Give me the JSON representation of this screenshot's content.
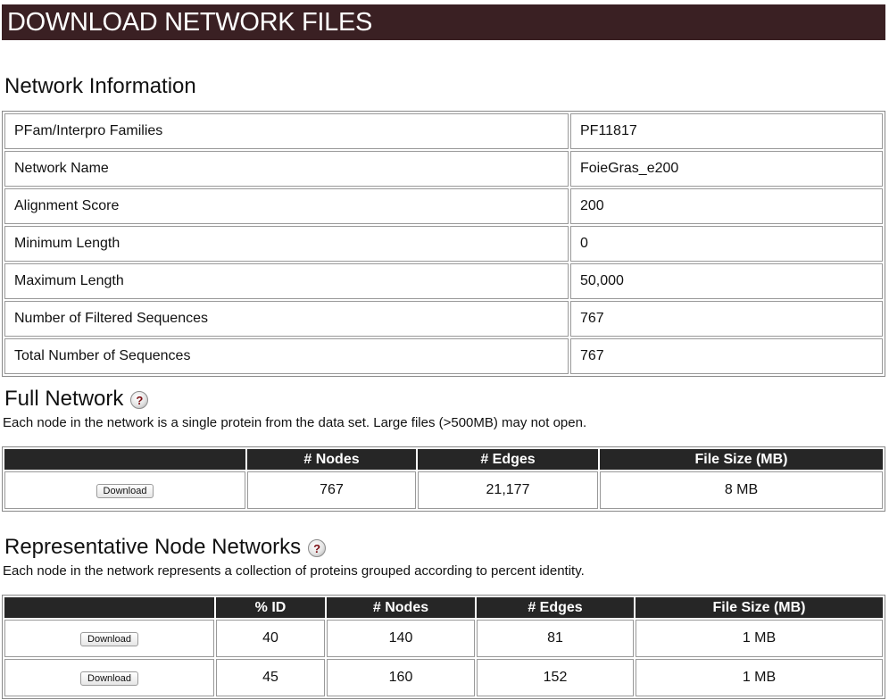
{
  "header": {
    "title": "DOWNLOAD NETWORK FILES"
  },
  "network_info": {
    "title": "Network Information",
    "rows": [
      {
        "label": "PFam/Interpro Families",
        "value": "PF11817"
      },
      {
        "label": "Network Name",
        "value": "FoieGras_e200"
      },
      {
        "label": "Alignment Score",
        "value": "200"
      },
      {
        "label": "Minimum Length",
        "value": "0"
      },
      {
        "label": "Maximum Length",
        "value": "50,000"
      },
      {
        "label": "Number of Filtered Sequences",
        "value": "767"
      },
      {
        "label": "Total Number of Sequences",
        "value": "767"
      }
    ]
  },
  "full_network": {
    "title": "Full Network",
    "help_icon": "question-mark-icon",
    "help_glyph": "?",
    "description": "Each node in the network is a single protein from the data set. Large files (>500MB) may not open.",
    "columns": [
      "",
      "# Nodes",
      "# Edges",
      "File Size (MB)"
    ],
    "rows": [
      {
        "button": "Download",
        "nodes": "767",
        "edges": "21,177",
        "size": "8 MB"
      }
    ]
  },
  "rep_networks": {
    "title": "Representative Node Networks",
    "help_icon": "question-mark-icon",
    "help_glyph": "?",
    "description": "Each node in the network represents a collection of proteins grouped according to percent identity.",
    "columns": [
      "",
      "% ID",
      "# Nodes",
      "# Edges",
      "File Size (MB)"
    ],
    "rows": [
      {
        "button": "Download",
        "pid": "40",
        "nodes": "140",
        "edges": "81",
        "size": "1 MB"
      },
      {
        "button": "Download",
        "pid": "45",
        "nodes": "160",
        "edges": "152",
        "size": "1 MB"
      }
    ]
  },
  "colors": {
    "header_bg": "#3a2023",
    "table_header_bg": "#262626",
    "help_icon_glyph": "#7a0f14"
  }
}
